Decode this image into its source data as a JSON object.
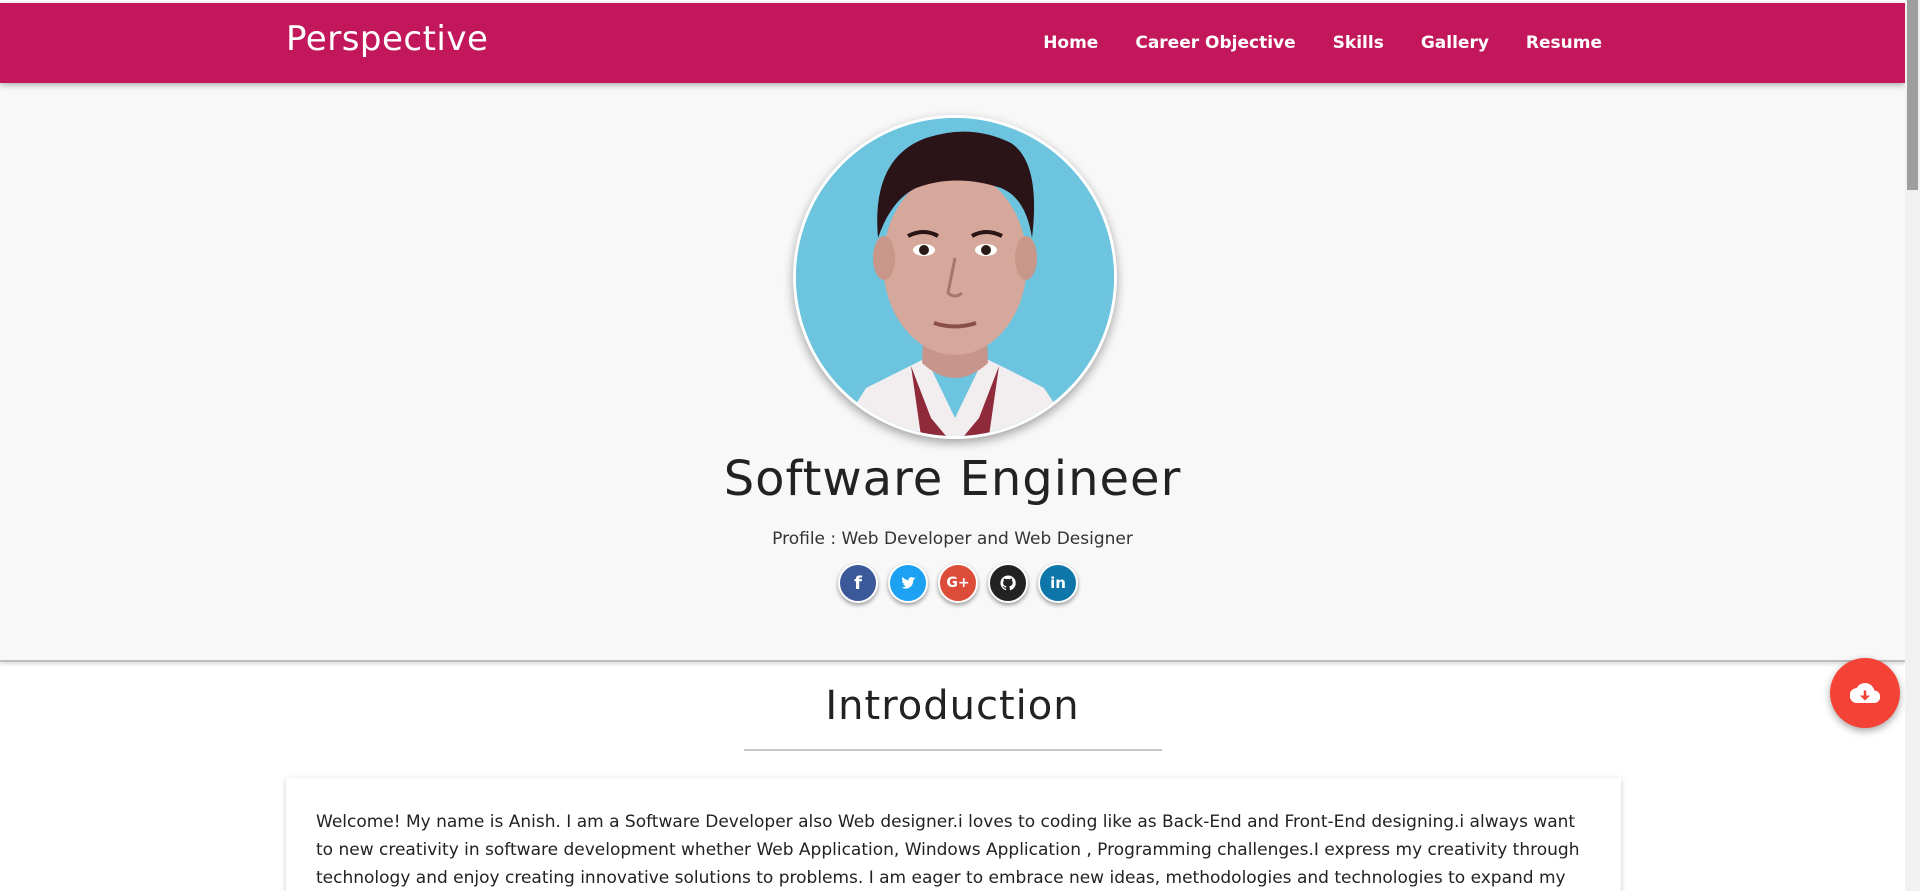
{
  "brand": "Perspective",
  "nav": [
    "Home",
    "Career Objective",
    "Skills",
    "Gallery",
    "Resume"
  ],
  "hero": {
    "title": "Software Engineer",
    "subtitle": "Profile : Web Developer and Web Designer",
    "social_icons": [
      "facebook-icon",
      "twitter-icon",
      "google-plus-icon",
      "github-icon",
      "linkedin-icon"
    ],
    "social_glyphs": {
      "facebook": "f",
      "twitter": "t",
      "google": "G+",
      "github": "⌥",
      "linkedin": "in"
    }
  },
  "intro": {
    "title": "Introduction",
    "text": "Welcome! My name is Anish. I am a Software Developer also Web designer.i loves to coding like as Back-End and Front-End designing.i always want to new creativity in software development whether Web Application, Windows Application , Programming challenges.I express my creativity through technology and enjoy creating innovative solutions to problems. I am eager to embrace new ideas, methodologies and technologies to expand my"
  },
  "fab_icon": "cloud-download-icon",
  "colors": {
    "primary": "#c2185b",
    "fab": "#f44336",
    "facebook": "#3b5998",
    "twitter": "#1da1f2",
    "google": "#dd4b39",
    "github": "#222222",
    "linkedin": "#0e76a8"
  }
}
